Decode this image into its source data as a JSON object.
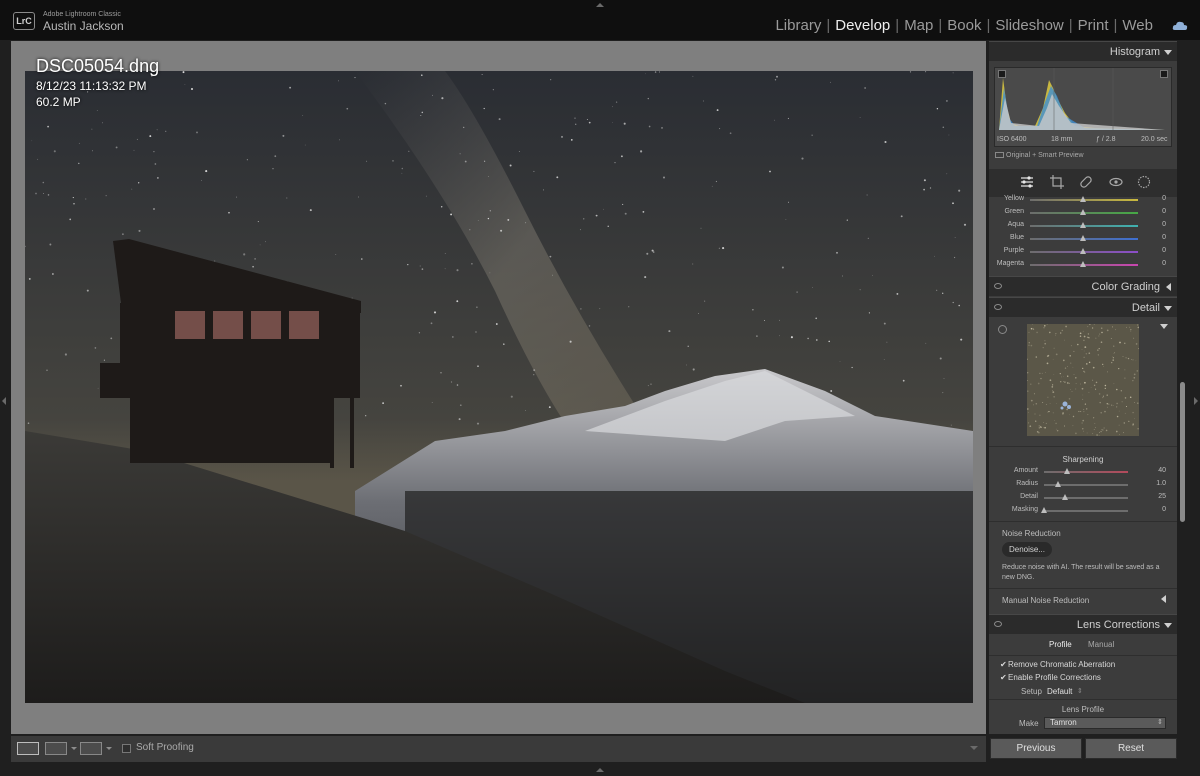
{
  "app": {
    "name": "Adobe Lightroom Classic",
    "badge": "LrC",
    "user": "Austin Jackson"
  },
  "modules": [
    "Library",
    "Develop",
    "Map",
    "Book",
    "Slideshow",
    "Print",
    "Web"
  ],
  "active_module": "Develop",
  "photo_info": {
    "filename": "DSC05054.dng",
    "datetime": "8/12/23 11:13:32 PM",
    "megapixels": "60.2 MP"
  },
  "toolbar": {
    "soft_proofing_label": "Soft Proofing"
  },
  "histogram": {
    "title": "Histogram",
    "iso": "ISO 6400",
    "focal": "18 mm",
    "aperture": "ƒ / 2.8",
    "shutter": "20.0 sec",
    "preview_status": "Original + Smart Preview"
  },
  "hsl": [
    {
      "label": "Yellow",
      "value": "0",
      "color": "#c9b93e"
    },
    {
      "label": "Green",
      "value": "0",
      "color": "#46a845"
    },
    {
      "label": "Aqua",
      "value": "0",
      "color": "#3fb1b0"
    },
    {
      "label": "Blue",
      "value": "0",
      "color": "#3e6fd1"
    },
    {
      "label": "Purple",
      "value": "0",
      "color": "#8c4ec9"
    },
    {
      "label": "Magenta",
      "value": "0",
      "color": "#c946b0"
    }
  ],
  "panels": {
    "color_grading": "Color Grading",
    "detail": "Detail",
    "lens_corrections": "Lens Corrections"
  },
  "sharpening": {
    "title": "Sharpening",
    "sliders": [
      {
        "label": "Amount",
        "value": "40",
        "fraction": 0.27
      },
      {
        "label": "Radius",
        "value": "1.0",
        "fraction": 0.17
      },
      {
        "label": "Detail",
        "value": "25",
        "fraction": 0.25
      },
      {
        "label": "Masking",
        "value": "0",
        "fraction": 0.0
      }
    ]
  },
  "noise_reduction": {
    "title": "Noise Reduction",
    "denoise_button": "Denoise...",
    "description": "Reduce noise with AI. The result will be saved as a new DNG.",
    "manual_label": "Manual Noise Reduction"
  },
  "lens_corrections": {
    "tabs": [
      "Profile",
      "Manual"
    ],
    "active_tab": "Profile",
    "remove_ca": "Remove Chromatic Aberration",
    "enable_profile": "Enable Profile Corrections",
    "setup_label": "Setup",
    "setup_value": "Default",
    "lens_profile_title": "Lens Profile",
    "make_label": "Make",
    "make_value": "Tamron"
  },
  "buttons": {
    "previous": "Previous",
    "reset": "Reset"
  },
  "colors": {
    "accent_active": "#eeeeee",
    "panel_bg": "#3c3c3c",
    "header_bg": "#2b2b2b"
  }
}
